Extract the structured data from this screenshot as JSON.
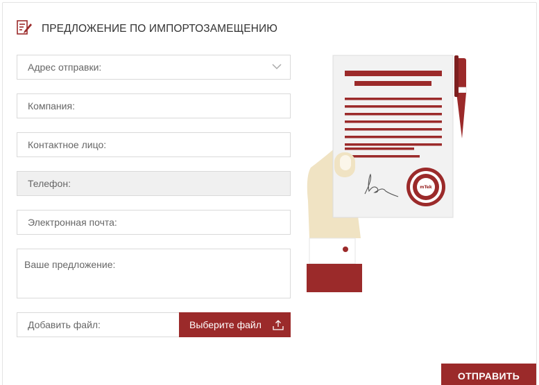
{
  "header": {
    "title": "ПРЕДЛОЖЕНИЕ ПО ИМПОРТОЗАМЕЩЕНИЮ",
    "icon": "document-pen-icon"
  },
  "form": {
    "address_placeholder": "Адрес отправки:",
    "company_placeholder": "Компания:",
    "contact_placeholder": "Контактное лицо:",
    "phone_placeholder": "Телефон:",
    "email_placeholder": "Электронная почта:",
    "proposal_placeholder": "Ваше предложение:",
    "file_label": "Добавить файл:",
    "file_button": "Выберите файл",
    "submit_label": "ОТПРАВИТЬ"
  },
  "illustration": {
    "stamp_text": "mTek"
  },
  "colors": {
    "accent": "#9b2a2a",
    "border": "#d9d9d9",
    "disabled_bg": "#f0f0f0",
    "hand": "#f0e3c3"
  }
}
